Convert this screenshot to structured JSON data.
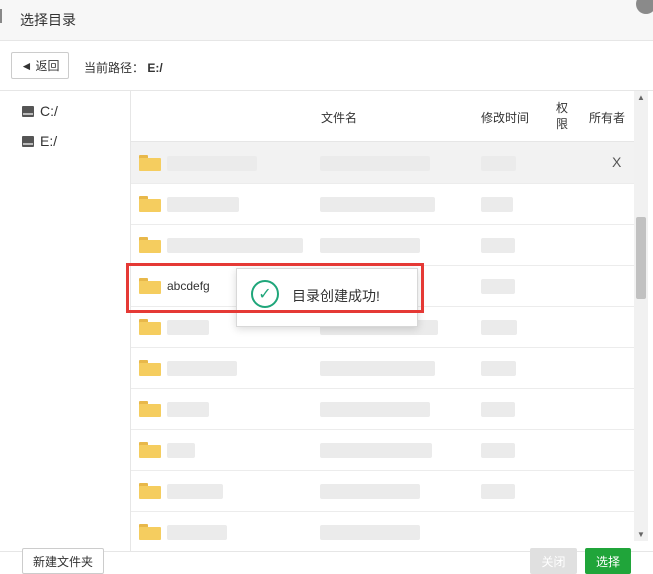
{
  "dialog": {
    "title": "选择目录"
  },
  "toolbar": {
    "back_label": "返回",
    "back_icon": "back-arrow-icon",
    "path_label": "当前路径：",
    "path_value": "E:/"
  },
  "tree": {
    "drives": [
      {
        "label": "C:/",
        "icon": "hard-drive-icon"
      },
      {
        "label": "E:/",
        "icon": "hard-drive-icon"
      }
    ]
  },
  "table": {
    "columns": {
      "name": "文件名",
      "modified": "修改时间",
      "permission": "权限",
      "owner": "所有者"
    },
    "rows": [
      {
        "name": ""
      },
      {
        "name": ""
      },
      {
        "name": ""
      },
      {
        "name": "abcdefg"
      },
      {
        "name": ""
      },
      {
        "name": ""
      },
      {
        "name": ""
      },
      {
        "name": ""
      },
      {
        "name": ""
      }
    ],
    "row_close_label": "X"
  },
  "toast": {
    "message": "目录创建成功!",
    "icon": "check-circle-icon",
    "color": "#1fa67a"
  },
  "footer": {
    "new_folder_label": "新建文件夹",
    "close_label": "关闭",
    "choose_label": "选择",
    "choose_color": "#20a53a"
  }
}
